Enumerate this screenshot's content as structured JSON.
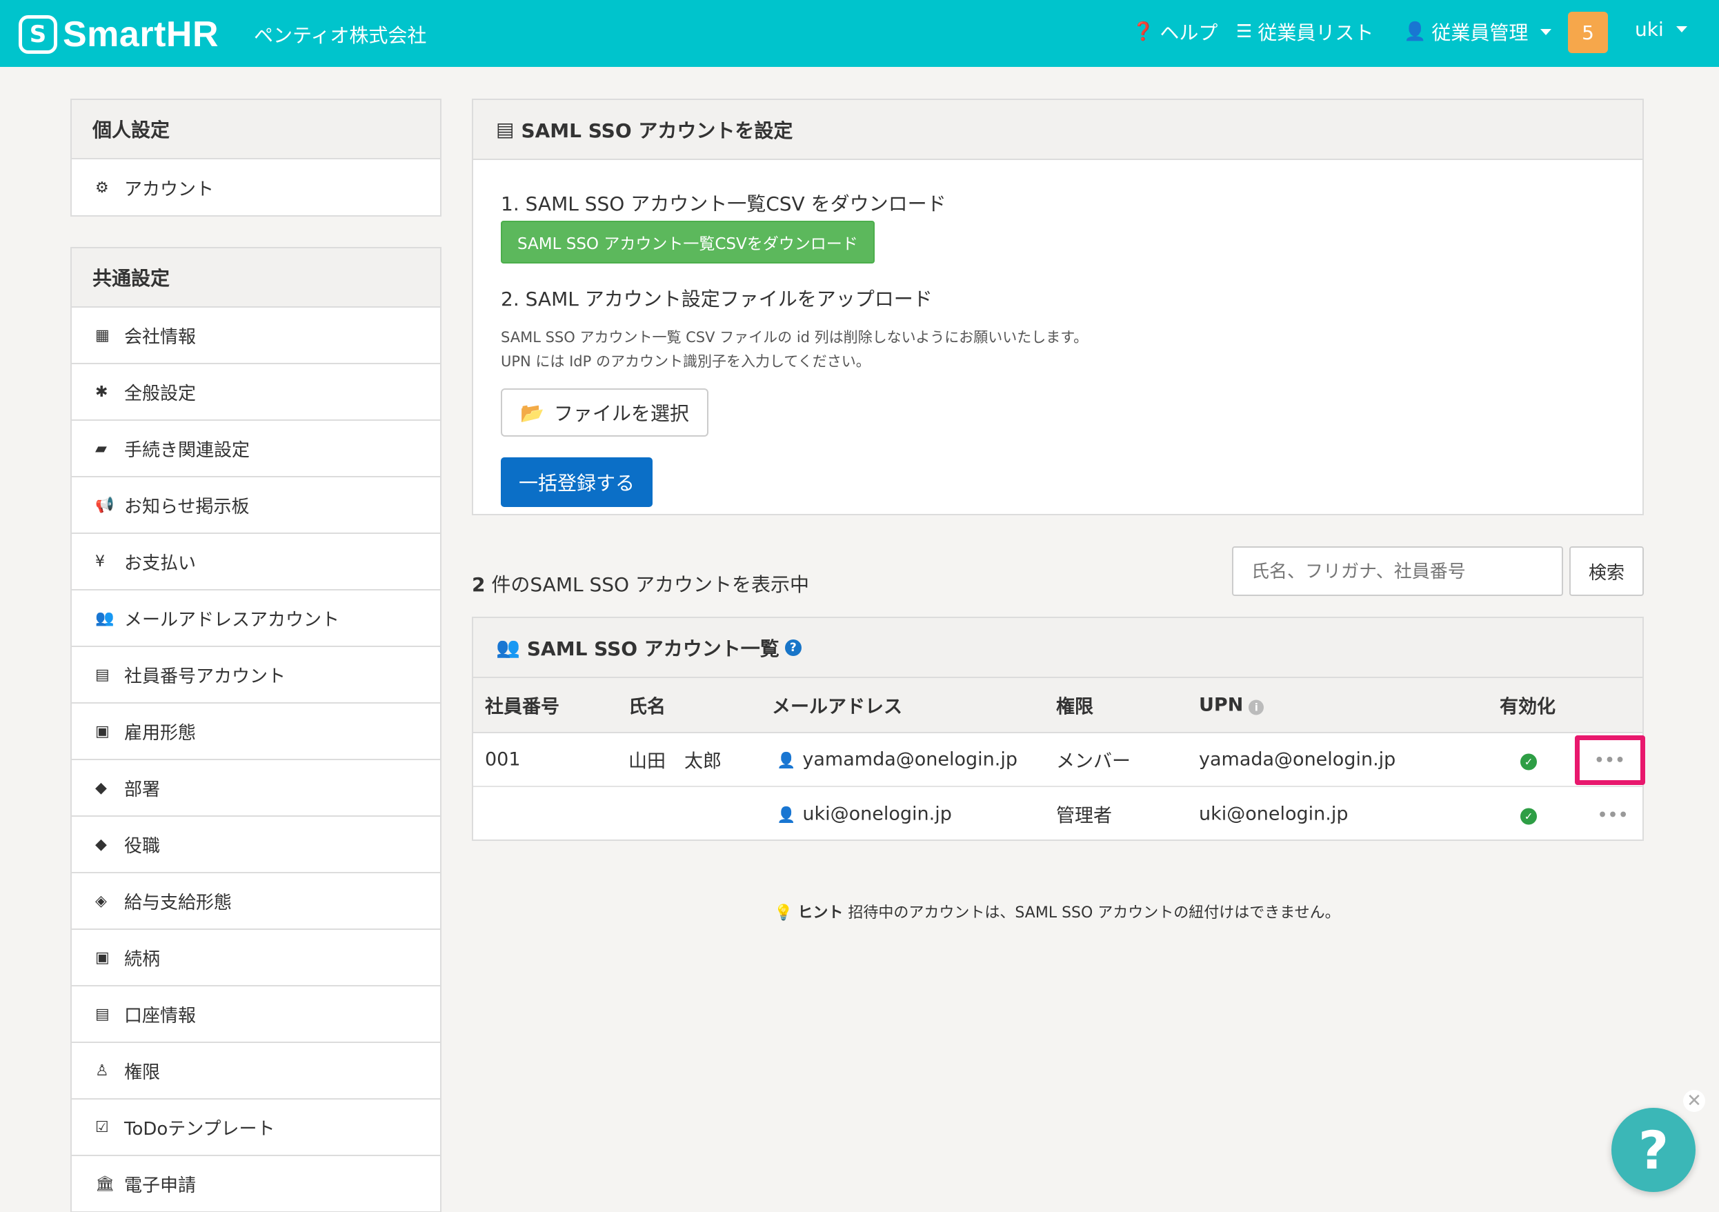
{
  "header": {
    "logo_mark": "S",
    "logo_text": "SmartHR",
    "company": "ペンティオ株式会社",
    "help": "ヘルプ",
    "employee_list": "従業員リスト",
    "employee_admin": "従業員管理",
    "notification_count": "5",
    "user": "uki",
    "colors": {
      "bar": "#00c4cc",
      "badge": "#f6a74b"
    }
  },
  "sidebar": {
    "personal_title": "個人設定",
    "personal_items": [
      {
        "icon": "gear-icon",
        "label": "アカウント"
      }
    ],
    "common_title": "共通設定",
    "common_items": [
      {
        "icon": "building-icon",
        "label": "会社情報"
      },
      {
        "icon": "asterisk-icon",
        "label": "全般設定"
      },
      {
        "icon": "book-icon",
        "label": "手続き関連設定"
      },
      {
        "icon": "megaphone-icon",
        "label": "お知らせ掲示板"
      },
      {
        "icon": "yen-icon",
        "label": "お支払い"
      },
      {
        "icon": "users-icon",
        "label": "メールアドレスアカウント"
      },
      {
        "icon": "id-card-icon",
        "label": "社員番号アカウント"
      },
      {
        "icon": "badge-icon",
        "label": "雇用形態"
      },
      {
        "icon": "tags-icon",
        "label": "部署"
      },
      {
        "icon": "tag-icon",
        "label": "役職"
      },
      {
        "icon": "money-icon",
        "label": "給与支給形態"
      },
      {
        "icon": "contact-icon",
        "label": "続柄"
      },
      {
        "icon": "list-alt-icon",
        "label": "口座情報"
      },
      {
        "icon": "user-key-icon",
        "label": "権限"
      },
      {
        "icon": "check-square-icon",
        "label": "ToDoテンプレート"
      },
      {
        "icon": "bank-icon",
        "label": "電子申請"
      }
    ]
  },
  "setup": {
    "title": "SAML SSO アカウントを設定",
    "step1": "1. SAML SSO アカウント一覧CSV をダウンロード",
    "download_button": "SAML SSO アカウント一覧CSVをダウンロード",
    "step2": "2. SAML アカウント設定ファイルをアップロード",
    "note_line1": "SAML SSO アカウント一覧 CSV ファイルの id 列は削除しないようにお願いいたします。",
    "note_line2": "UPN には IdP のアカウント識別子を入力してください。",
    "file_button": "ファイルを選択",
    "submit_button": "一括登録する"
  },
  "list": {
    "count_number": "2",
    "count_text": " 件のSAML SSO アカウントを表示中",
    "search_placeholder": "氏名、フリガナ、社員番号",
    "search_button": "検索",
    "title": "SAML SSO アカウント一覧",
    "columns": {
      "employee_no": "社員番号",
      "name": "氏名",
      "email": "メールアドレス",
      "role": "権限",
      "upn": "UPN",
      "enabled": "有効化"
    },
    "rows": [
      {
        "employee_no": "001",
        "name": "山田　太郎",
        "email": "yamamda@onelogin.jp",
        "role": "メンバー",
        "upn": "yamada@onelogin.jp",
        "enabled": true
      },
      {
        "employee_no": "",
        "name": "",
        "email": "uki@onelogin.jp",
        "role": "管理者",
        "upn": "uki@onelogin.jp",
        "enabled": true
      }
    ]
  },
  "hint": {
    "label": "ヒント",
    "text": " 招待中のアカウントは、SAML SSO アカウントの紐付けはできません。"
  },
  "fab": {
    "help": "?",
    "close": "✕"
  }
}
